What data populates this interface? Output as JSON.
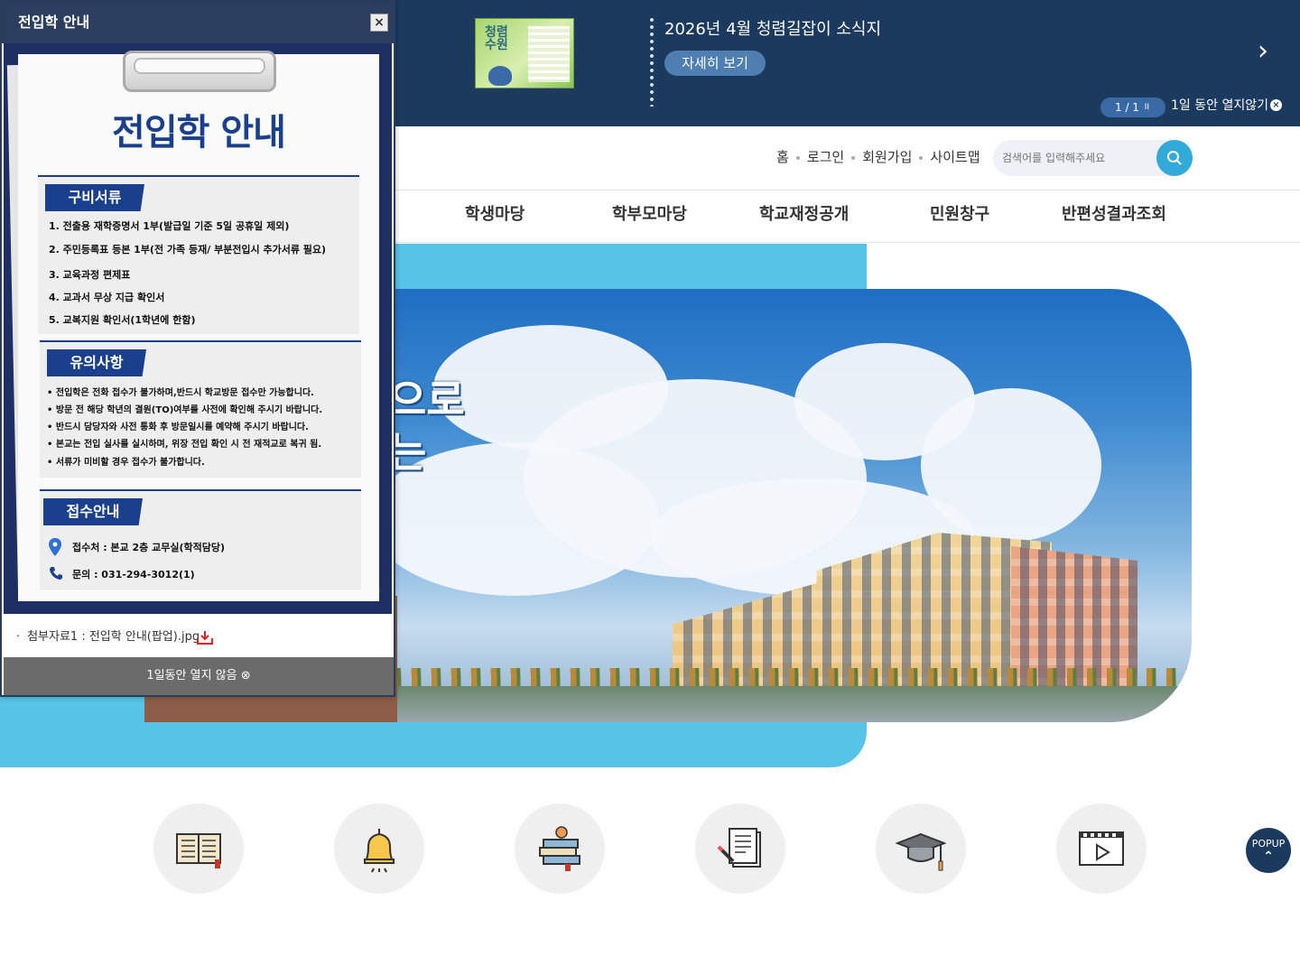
{
  "banner": {
    "news_title": "2026년 4월 청렴길잡이 소식지",
    "more_label": "자세히 보기",
    "pager": "1 / 1",
    "pause_icon": "II",
    "no_open_label": "1일 동안 열지않기",
    "thumb_title": "청렴 수원"
  },
  "util": {
    "home": "홈",
    "login": "로그인",
    "join": "회원가입",
    "sitemap": "사이트맵",
    "search_placeholder": "검색어를 입력해주세요"
  },
  "gnb": [
    "학생마당",
    "학부모마당",
    "학교재정공개",
    "민원창구",
    "반편성결과조회"
  ],
  "hero": {
    "line1": "으로",
    "line2": "는"
  },
  "quick_icons": [
    "book-icon",
    "bell-icon",
    "books-apple-icon",
    "document-pen-icon",
    "graduation-cap-icon",
    "video-icon"
  ],
  "popup_button": {
    "line1": "POPUP"
  },
  "popup": {
    "header_title": "전입학 안내",
    "close_glyph": "×",
    "doc_title": "전입학 안내",
    "section1": {
      "label": "구비서류",
      "items": [
        "1. 전출용 재학증명서 1부(발급일 기준 5일 공휴일 제외)",
        "2. 주민등록표 등본 1부(전 가족 등재/ 부분전입시 추가서류 필요)",
        "3. 교육과정 편제표",
        "4. 교과서 무상 지급 확인서",
        "5. 교복지원 확인서(1학년에 한함)"
      ]
    },
    "section2": {
      "label": "유의사항",
      "items": [
        "• 전입학은 전화 접수가 불가하며,반드시 학교방문 접수만 가능합니다.",
        "• 방문 전 해당 학년의 결원(TO)여부를 사전에 확인해 주시기 바랍니다.",
        "• 반드시 담당자와 사전 통화 후 방문일시를 예약해 주시기 바랍니다.",
        "• 본교는 전입 실사를 실시하며, 위장 전입 확인 시 전 재적교로 복귀 됨.",
        "• 서류가 미비할 경우 접수가 불가합니다."
      ]
    },
    "section3": {
      "label": "접수안내",
      "place": "접수처 : 본교 2층 교무실(학적담당)",
      "phone": "문의 : 031-294-3012(1)"
    },
    "attachment": "ㆍ 첨부자료1 : 전입학 안내(팝업).jpg",
    "footer": "1일동안 열지 않음 ⊗"
  },
  "colors": {
    "banner_bg": "#1b3a5e",
    "accent_blue": "#31a9d9",
    "hero_bg": "#57c3e6",
    "popup_header": "#2c3e5d",
    "doc_blue": "#1a3f8c"
  }
}
